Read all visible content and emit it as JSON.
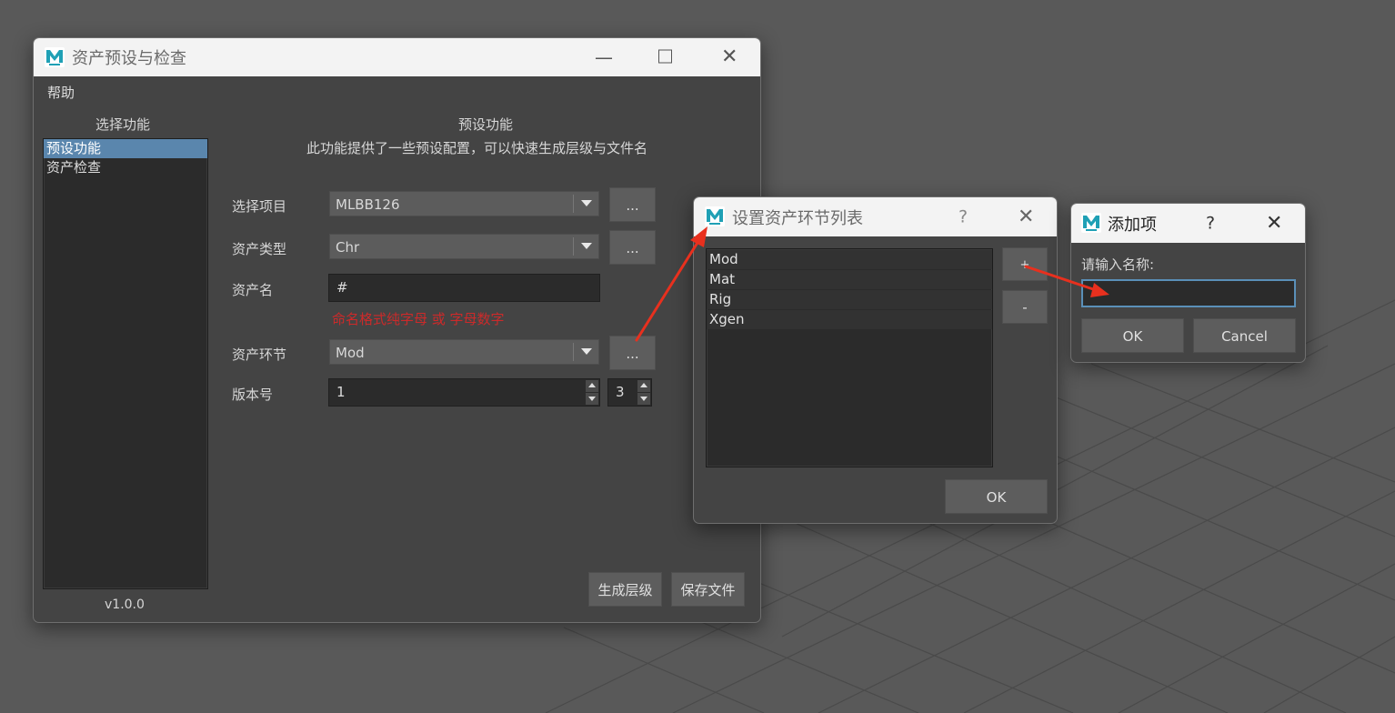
{
  "main_window": {
    "title": "资产预设与检查",
    "menu": {
      "help": "帮助"
    },
    "sidebar": {
      "header": "选择功能",
      "items": [
        {
          "label": "预设功能",
          "selected": true
        },
        {
          "label": "资产检查",
          "selected": false
        }
      ],
      "version": "v1.0.0"
    },
    "panel": {
      "title": "预设功能",
      "description": "此功能提供了一些预设配置，可以快速生成层级与文件名",
      "project": {
        "label": "选择项目",
        "value": "MLBB126",
        "more": "..."
      },
      "asset_type": {
        "label": "资产类型",
        "value": "Chr",
        "more": "..."
      },
      "asset_name": {
        "label": "资产名",
        "value": "#",
        "hint": "命名格式纯字母 或 字母数字"
      },
      "asset_stage": {
        "label": "资产环节",
        "value": "Mod",
        "more": "..."
      },
      "version": {
        "label": "版本号",
        "major": "1",
        "minor": "3"
      }
    },
    "buttons": {
      "generate": "生成层级",
      "save": "保存文件"
    }
  },
  "stage_dialog": {
    "title": "设置资产环节列表",
    "help": "?",
    "items": [
      "Mod",
      "Mat",
      "Rig",
      "Xgen"
    ],
    "add": "+",
    "remove": "-",
    "ok": "OK"
  },
  "add_dialog": {
    "title": "添加项",
    "help": "?",
    "prompt": "请输入名称:",
    "input_value": "",
    "ok": "OK",
    "cancel": "Cancel"
  },
  "colors": {
    "hint_red": "#cc2a2a",
    "selection": "#5a86ad",
    "arrow_red": "#e8301e",
    "focus_border": "#5a8fb8"
  }
}
